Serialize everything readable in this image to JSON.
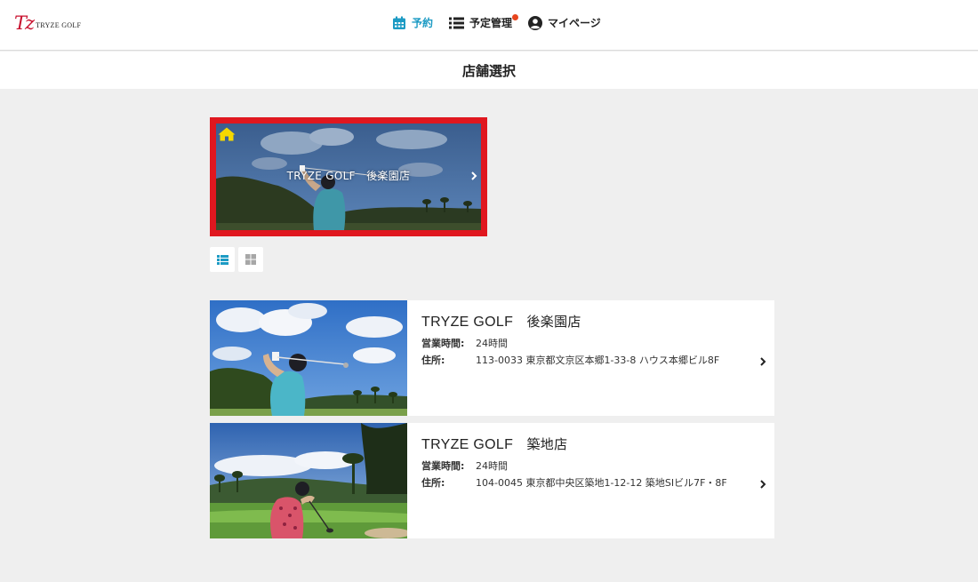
{
  "header": {
    "logo_mark": "Tz",
    "logo_text": "TRYZE GOLF",
    "nav": [
      {
        "label": "予約",
        "icon": "calendar-icon",
        "active": true
      },
      {
        "label": "予定管理",
        "icon": "list-icon",
        "badge": true
      },
      {
        "label": "マイページ",
        "icon": "user-circle-icon"
      }
    ],
    "accent_color": "#1d9bc4",
    "badge_color": "#e8451e"
  },
  "page_title": "店舗選択",
  "home_store": {
    "label": "TRYZE GOLF　後楽園店",
    "icon": "home-icon",
    "highlight_color": "#e0171f",
    "icon_color": "#f5d800"
  },
  "view_toggle": {
    "list_icon": "list-view-icon",
    "grid_icon": "grid-view-icon",
    "selected": "list"
  },
  "stores": [
    {
      "brand": "TRYZE GOLF",
      "name": "後楽園店",
      "hours_label": "営業時間:",
      "hours": "24時間",
      "address_label": "住所:",
      "address": "113-0033 東京都文京区本郷1-33-8 ハウス本郷ビル8F"
    },
    {
      "brand": "TRYZE GOLF",
      "name": "築地店",
      "hours_label": "営業時間:",
      "hours": "24時間",
      "address_label": "住所:",
      "address": "104-0045 東京都中央区築地1-12-12 築地SIビル7F・8F"
    }
  ]
}
